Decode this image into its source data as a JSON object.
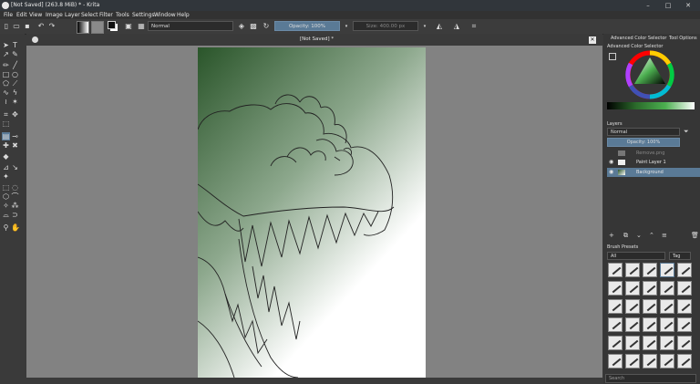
{
  "window": {
    "title": "[Not Saved]  (263.8 MiB)  * - Krita"
  },
  "menu": [
    "File",
    "Edit",
    "View",
    "Image",
    "Layer",
    "Select",
    "Filter",
    "Tools",
    "Settings",
    "Window",
    "Help"
  ],
  "toolbar": {
    "blend_mode": "Normal",
    "opacity": "Opacity: 100%",
    "size": "Size: 400.00 px"
  },
  "document": {
    "tab_title": "[Not Saved]  *"
  },
  "docker": {
    "tab_active": "Advanced Color Selector",
    "tab_other": "Tool Options",
    "color_section_title": "Advanced Color Selector",
    "layers_title": "Layers",
    "layer_blend": "Normal",
    "layer_opacity": "Opacity:  100%",
    "layers": [
      {
        "name": "Remove.png"
      },
      {
        "name": "Paint Layer 1"
      },
      {
        "name": "Background"
      }
    ],
    "presets_title": "Brush Presets",
    "presets_filter": "All",
    "presets_tag": "Tag",
    "search_placeholder": "Search"
  },
  "colors": {
    "accent": "#5a7a96",
    "titlebar": "#31363b",
    "canvas_bg": "#828282",
    "gradient_dark": "#2f5a2f"
  }
}
